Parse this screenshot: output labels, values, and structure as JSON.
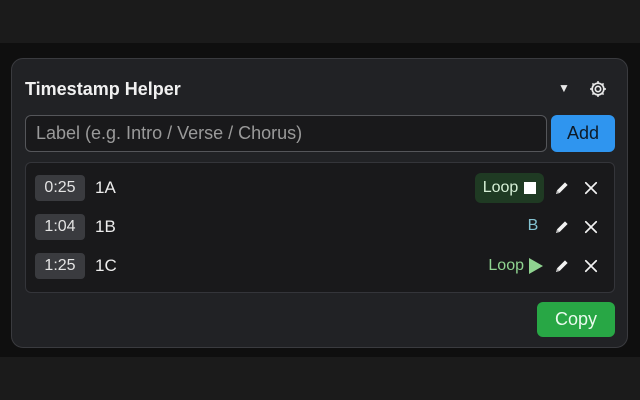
{
  "header": {
    "title": "Timestamp Helper",
    "menu_icon": "caret-down-icon",
    "settings_icon": "gear-icon"
  },
  "label_input": {
    "value": "",
    "placeholder": "Label (e.g. Intro / Verse / Chorus)"
  },
  "add_label": "Add",
  "copy_label": "Copy",
  "colors": {
    "accent_blue": "#2f95ef",
    "accent_green": "#28a745",
    "loop_green": "#8fd390"
  },
  "rows": [
    {
      "time": "0:25",
      "name": "1A",
      "loop_label": "Loop",
      "loop_state": "active",
      "loop_icon": "stop-icon",
      "edit_icon": "pencil-icon",
      "delete_icon": "close-icon"
    },
    {
      "time": "1:04",
      "name": "1B",
      "b_label": "B",
      "edit_icon": "pencil-icon",
      "delete_icon": "close-icon"
    },
    {
      "time": "1:25",
      "name": "1C",
      "loop_label": "Loop",
      "loop_state": "idle",
      "loop_icon": "play-icon",
      "edit_icon": "pencil-icon",
      "delete_icon": "close-icon"
    }
  ]
}
